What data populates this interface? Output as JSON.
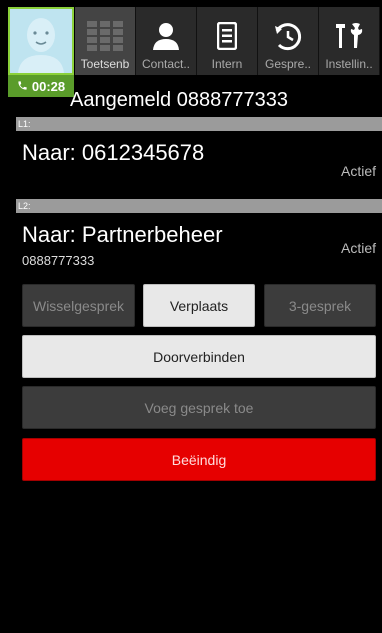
{
  "call": {
    "timer": "00:28"
  },
  "tabs": [
    {
      "label": "Toetsenb",
      "icon": "keypad-icon",
      "active": true
    },
    {
      "label": "Contact..",
      "icon": "contact-icon",
      "active": false
    },
    {
      "label": "Intern",
      "icon": "list-icon",
      "active": false
    },
    {
      "label": "Gespre..",
      "icon": "call-history-icon",
      "active": false
    },
    {
      "label": "Instellin..",
      "icon": "tools-icon",
      "active": false
    }
  ],
  "login_text": "Aangemeld 0888777333",
  "lines": [
    {
      "section": "L1:",
      "to": "Naar: 0612345678",
      "number": "",
      "status": "Actief"
    },
    {
      "section": "L2:",
      "to": "Naar: Partnerbeheer",
      "number": "0888777333",
      "status": "Actief"
    }
  ],
  "buttons": {
    "switch": "Wisselgesprek",
    "move": "Verplaats",
    "three_way": "3-gesprek",
    "transfer": "Doorverbinden",
    "add_call": "Voeg gesprek toe",
    "end": "Beëindig"
  },
  "colors": {
    "accent_green": "#8bd13a",
    "end_red": "#e60000"
  }
}
